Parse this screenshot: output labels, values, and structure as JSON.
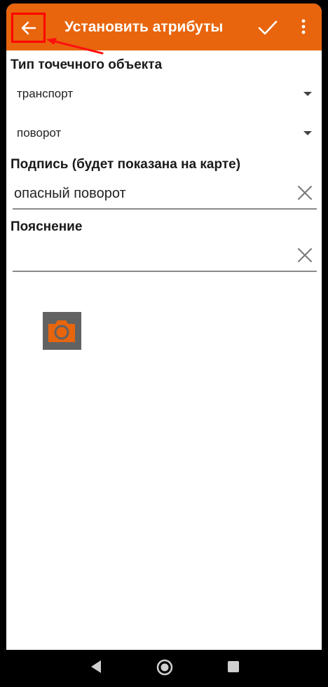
{
  "appbar": {
    "title": "Установить атрибуты",
    "back_icon": "arrow-left-icon",
    "confirm_icon": "checkmark-icon",
    "more_icon": "more-vert-icon",
    "color": "#e8650d",
    "highlight_color": "#ff0000"
  },
  "form": {
    "point_type_label": "Тип точечного объекта",
    "category_value": "транспорт",
    "subtype_value": "поворот",
    "caption_label": "Подпись (будет показана на карте)",
    "caption_value": "опасный поворот",
    "note_label": "Пояснение",
    "note_value": ""
  },
  "photo": {
    "icon": "camera-icon"
  },
  "navbar": {
    "back_icon": "nav-back-icon",
    "home_icon": "nav-home-icon",
    "recent_icon": "nav-recent-icon"
  }
}
